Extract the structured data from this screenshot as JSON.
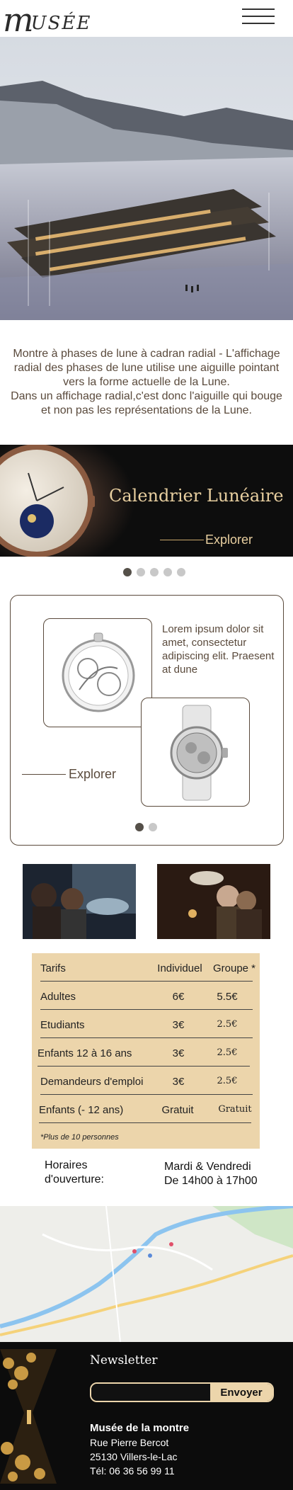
{
  "header": {
    "logo_initial": "m",
    "logo_rest": "USÉE"
  },
  "intro": {
    "line1": "Montre à phases de lune à cadran radial - L'affichage radial des phases de lune utilise une aiguille pointant vers la forme actuelle de la Lune.",
    "line2": "Dans un affichage radial,c'est donc l'aiguille qui bouge et non pas les représentations de la Lune."
  },
  "banner": {
    "title": "Calendrier Lunéaire",
    "explore": "Explorer"
  },
  "carousel1": {
    "count": 5,
    "active": 1
  },
  "card": {
    "text": "Lorem ipsum dolor sit amet, consectetur adipiscing elit. Praesent at dune",
    "explore": "Explorer"
  },
  "carousel2": {
    "count": 2,
    "active": 1
  },
  "pricing": {
    "headers": [
      "Tarifs",
      "Individuel",
      "Groupe *"
    ],
    "rows": [
      [
        "Adultes",
        "6€",
        "5.5€"
      ],
      [
        "Etudiants",
        "3€",
        "2.5€"
      ],
      [
        "Enfants 12 à 16 ans",
        "3€",
        "2.5€"
      ],
      [
        "Demandeurs d'emploi",
        "3€",
        "2.5€"
      ],
      [
        "Enfants (- 12 ans)",
        "Gratuit",
        "Gratuit"
      ]
    ],
    "note": "*Plus de 10 personnes"
  },
  "hours": {
    "label_line1": "Horaires",
    "label_line2": "d'ouverture:",
    "value_line1": "Mardi & Vendredi",
    "value_line2": "De 14h00 à 17h00"
  },
  "footer": {
    "newsletter_title": "Newsletter",
    "input_placeholder": "",
    "button": "Envoyer",
    "name": "Musée de la montre",
    "street": "Rue Pierre Bercot",
    "city": "25130 Villers-le-Lac",
    "phone": "Tél:  06 36 56 99 11"
  },
  "colors": {
    "accent": "#ecd5ab",
    "brown": "#5a4a3c",
    "dark": "#0c0c0c"
  }
}
